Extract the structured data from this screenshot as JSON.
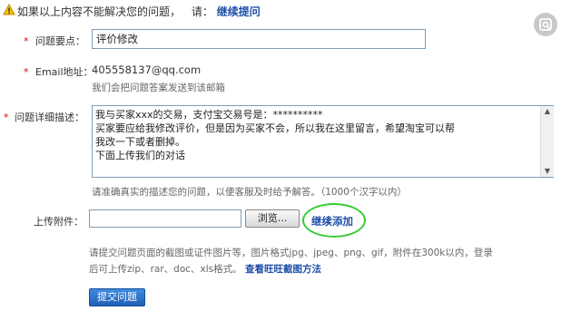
{
  "header": {
    "question_text": "如果以上内容不能解决您的问题，",
    "please_text": "请：",
    "continue_link": "继续提问"
  },
  "form": {
    "required_mark": "*",
    "subject_label": "问题要点：",
    "subject_value": "评价修改",
    "email_label": "Email地址：",
    "email_value": "405558137@qq.com",
    "email_hint": "我们会把问题答案发送到该邮箱",
    "detail_label": "问题详细描述：",
    "detail_lines": [
      "我与买家xxx的交易，支付宝交易号是：**********",
      "买家要应给我修改评价，但是因为买家不会，所以我在这里留言，希望淘宝可以帮",
      "我改一下或者删掉。",
      "下面上传我们的对话"
    ],
    "detail_hint": "请准确真实的描述您的问题，以便客服及时给予解答。（1000个汉字以内）",
    "attach_label": "上传附件：",
    "browse_button": "浏览...",
    "add_more_link": "继续添加",
    "attach_hint_line1": "请提交问题页面的截图或证件图片等，图片格式jpg、jpeg、png、gif，附件在300k以内，登录",
    "attach_hint_line2_prefix": "后可上传zip、rar、doc、xls格式。",
    "attach_hint_link": "查看旺旺截图方法",
    "submit_button": "提交问题"
  },
  "colors": {
    "highlight_circle": "#33cc33",
    "link": "#1f4fa8",
    "required": "#e60000"
  },
  "icons": {
    "warning": "warning-icon",
    "lens": "lens-icon"
  }
}
